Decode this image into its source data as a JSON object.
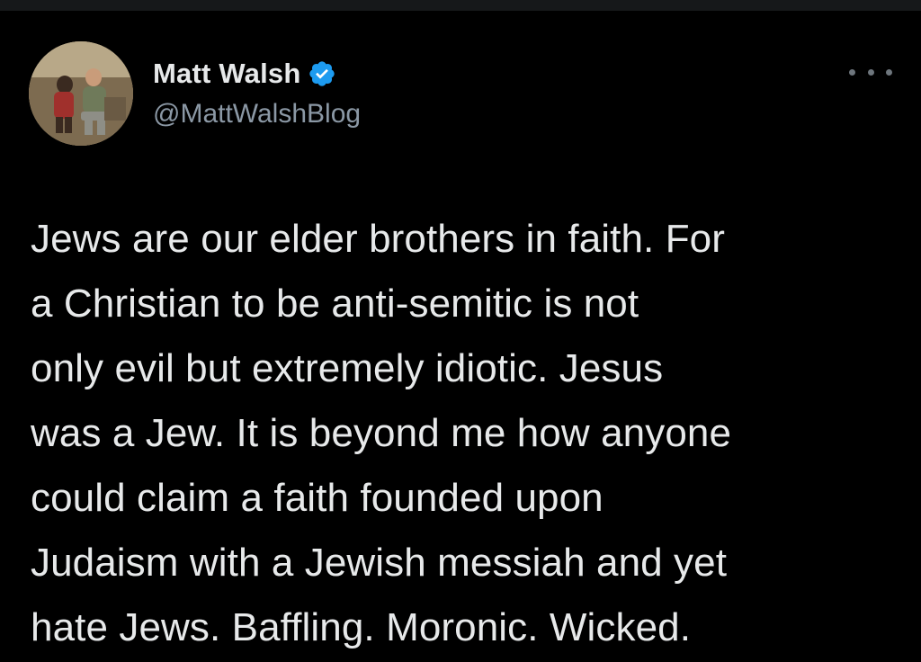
{
  "author": {
    "display_name": "Matt Walsh",
    "handle": "@MattWalshBlog",
    "verified": true,
    "avatar_icon": "profile-photo"
  },
  "menu": {
    "icon": "more-options-icon"
  },
  "tweet": {
    "lines": [
      "Jews are our elder brothers in faith. For",
      "a Christian to be anti-semitic is not",
      "only evil but extremely idiotic. Jesus",
      "was a Jew. It is beyond me how anyone",
      "could claim a faith founded upon",
      "Judaism with a Jewish messiah and yet",
      "hate Jews. Baffling. Moronic. Wicked."
    ]
  },
  "colors": {
    "background": "#000000",
    "text": "#e7e9ea",
    "secondary_text": "#8b98a5",
    "verified_badge": "#1d9bf0"
  }
}
